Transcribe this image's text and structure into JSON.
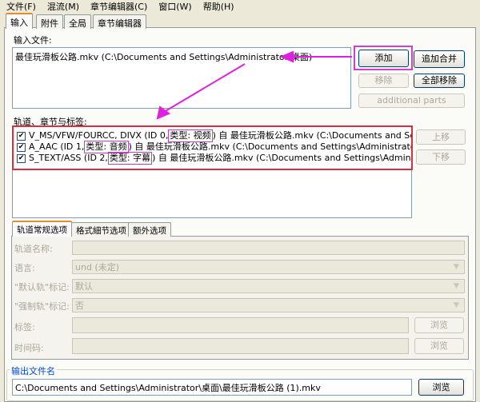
{
  "menu": [
    "文件(F)",
    "混流(M)",
    "章节编辑器(C)",
    "窗口(W)",
    "帮助(H)"
  ],
  "tabs": [
    "输入",
    "附件",
    "全局",
    "章节编辑器"
  ],
  "input": {
    "label": "输入文件:",
    "files": [
      "最佳玩滑板公路.mkv (C:\\Documents and Settings\\Administrator\\桌面)"
    ],
    "add": "添加",
    "append": "追加合并",
    "remove": "移除",
    "remove_all": "全部移除",
    "additional": "additional parts"
  },
  "tracks": {
    "label": "轨道、章节与标签:",
    "up": "上移",
    "down": "下移",
    "items": [
      {
        "checked": true,
        "pre": "V_MS/VFW/FOURCC, DIVX (ID 0,",
        "type": "类型: 视频",
        "post": ") 自 最佳玩滑板公路.mkv (C:\\Documents and Settings\\Ad"
      },
      {
        "checked": true,
        "pre": "A_AAC (ID 1,",
        "type": "类型: 音频",
        "post": ") 自 最佳玩滑板公路.mkv (C:\\Documents and Settings\\Administrator\\桌面)"
      },
      {
        "checked": true,
        "pre": "S_TEXT/ASS (ID 2,",
        "type": "类型: 字幕",
        "post": ") 自 最佳玩滑板公路.mkv (C:\\Documents and Settings\\Administrator\\桌"
      }
    ]
  },
  "subtabs": [
    "轨道常规选项",
    "格式細节选项",
    "额外选项"
  ],
  "options": {
    "name_label": "轨道名称:",
    "name": "",
    "lang_label": "语言:",
    "lang": "und (未定)",
    "default_label": "\"默认轨\"标记:",
    "default": "默认",
    "forced_label": "\"强制轨\"标记:",
    "forced": "否",
    "tags_label": "标签:",
    "timecode_label": "时间码:",
    "browse": "浏览"
  },
  "output": {
    "label": "输出文件名",
    "value": "C:\\Documents and Settings\\Administrator\\桌面\\最佳玩滑板公路 (1).mkv",
    "browse": "浏览"
  },
  "colors": {
    "annotation": "#e020e0",
    "highlight_box": "#e03040"
  }
}
